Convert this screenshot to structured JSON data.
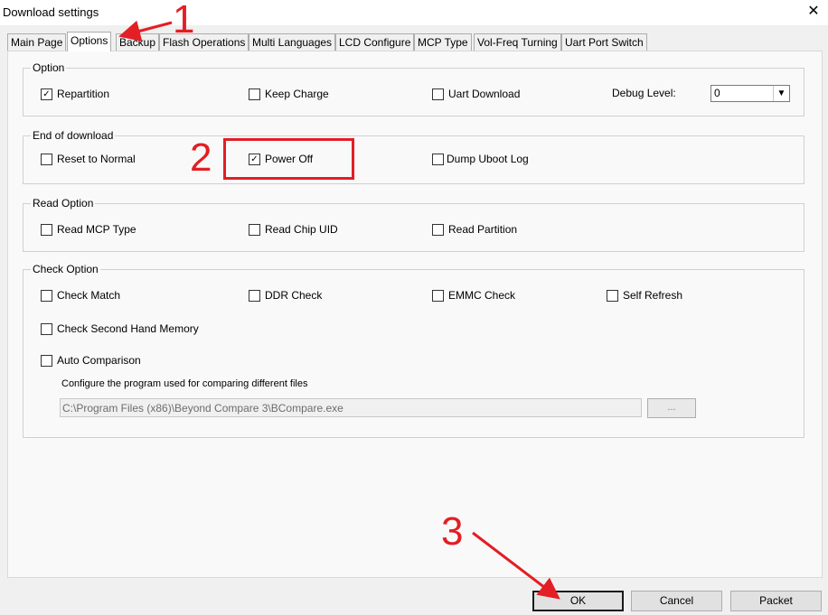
{
  "window": {
    "title": "Download settings"
  },
  "tabs": [
    "Main Page",
    "Options",
    "Backup",
    "Flash Operations",
    "Multi Languages",
    "LCD Configure",
    "MCP Type",
    "Vol-Freq Turning",
    "Uart Port Switch"
  ],
  "active_tab": "Options",
  "option_group": {
    "label": "Option",
    "items": [
      {
        "label": "Repartition",
        "checked": true
      },
      {
        "label": "Keep Charge",
        "checked": false
      },
      {
        "label": "Uart Download",
        "checked": false
      }
    ],
    "debug_level_label": "Debug Level:",
    "debug_level_value": "0"
  },
  "end_group": {
    "label": "End of download",
    "items": [
      {
        "label": "Reset to Normal",
        "checked": false
      },
      {
        "label": "Power Off",
        "checked": true
      },
      {
        "label": "Dump Uboot Log",
        "checked": false
      }
    ]
  },
  "read_group": {
    "label": "Read Option",
    "items": [
      {
        "label": "Read MCP Type",
        "checked": false
      },
      {
        "label": "Read Chip UID",
        "checked": false
      },
      {
        "label": "Read Partition",
        "checked": false
      }
    ]
  },
  "check_group": {
    "label": "Check Option",
    "items": [
      {
        "label": "Check Match",
        "checked": false
      },
      {
        "label": "DDR Check",
        "checked": false
      },
      {
        "label": "EMMC Check",
        "checked": false
      },
      {
        "label": "Self Refresh",
        "checked": false
      },
      {
        "label": "Check Second Hand Memory",
        "checked": false
      },
      {
        "label": "Auto Comparison",
        "checked": false
      }
    ],
    "compare_desc": "Configure the program used for comparing different files",
    "compare_path": "C:\\Program Files (x86)\\Beyond Compare 3\\BCompare.exe",
    "browse_label": "..."
  },
  "buttons": {
    "ok": "OK",
    "cancel": "Cancel",
    "packet": "Packet"
  },
  "annotations": {
    "n1": "1",
    "n2": "2",
    "n3": "3",
    "color": "#e31e24"
  },
  "glyphs": {
    "close": "✕",
    "check": "✓",
    "dropdown": "▼"
  }
}
